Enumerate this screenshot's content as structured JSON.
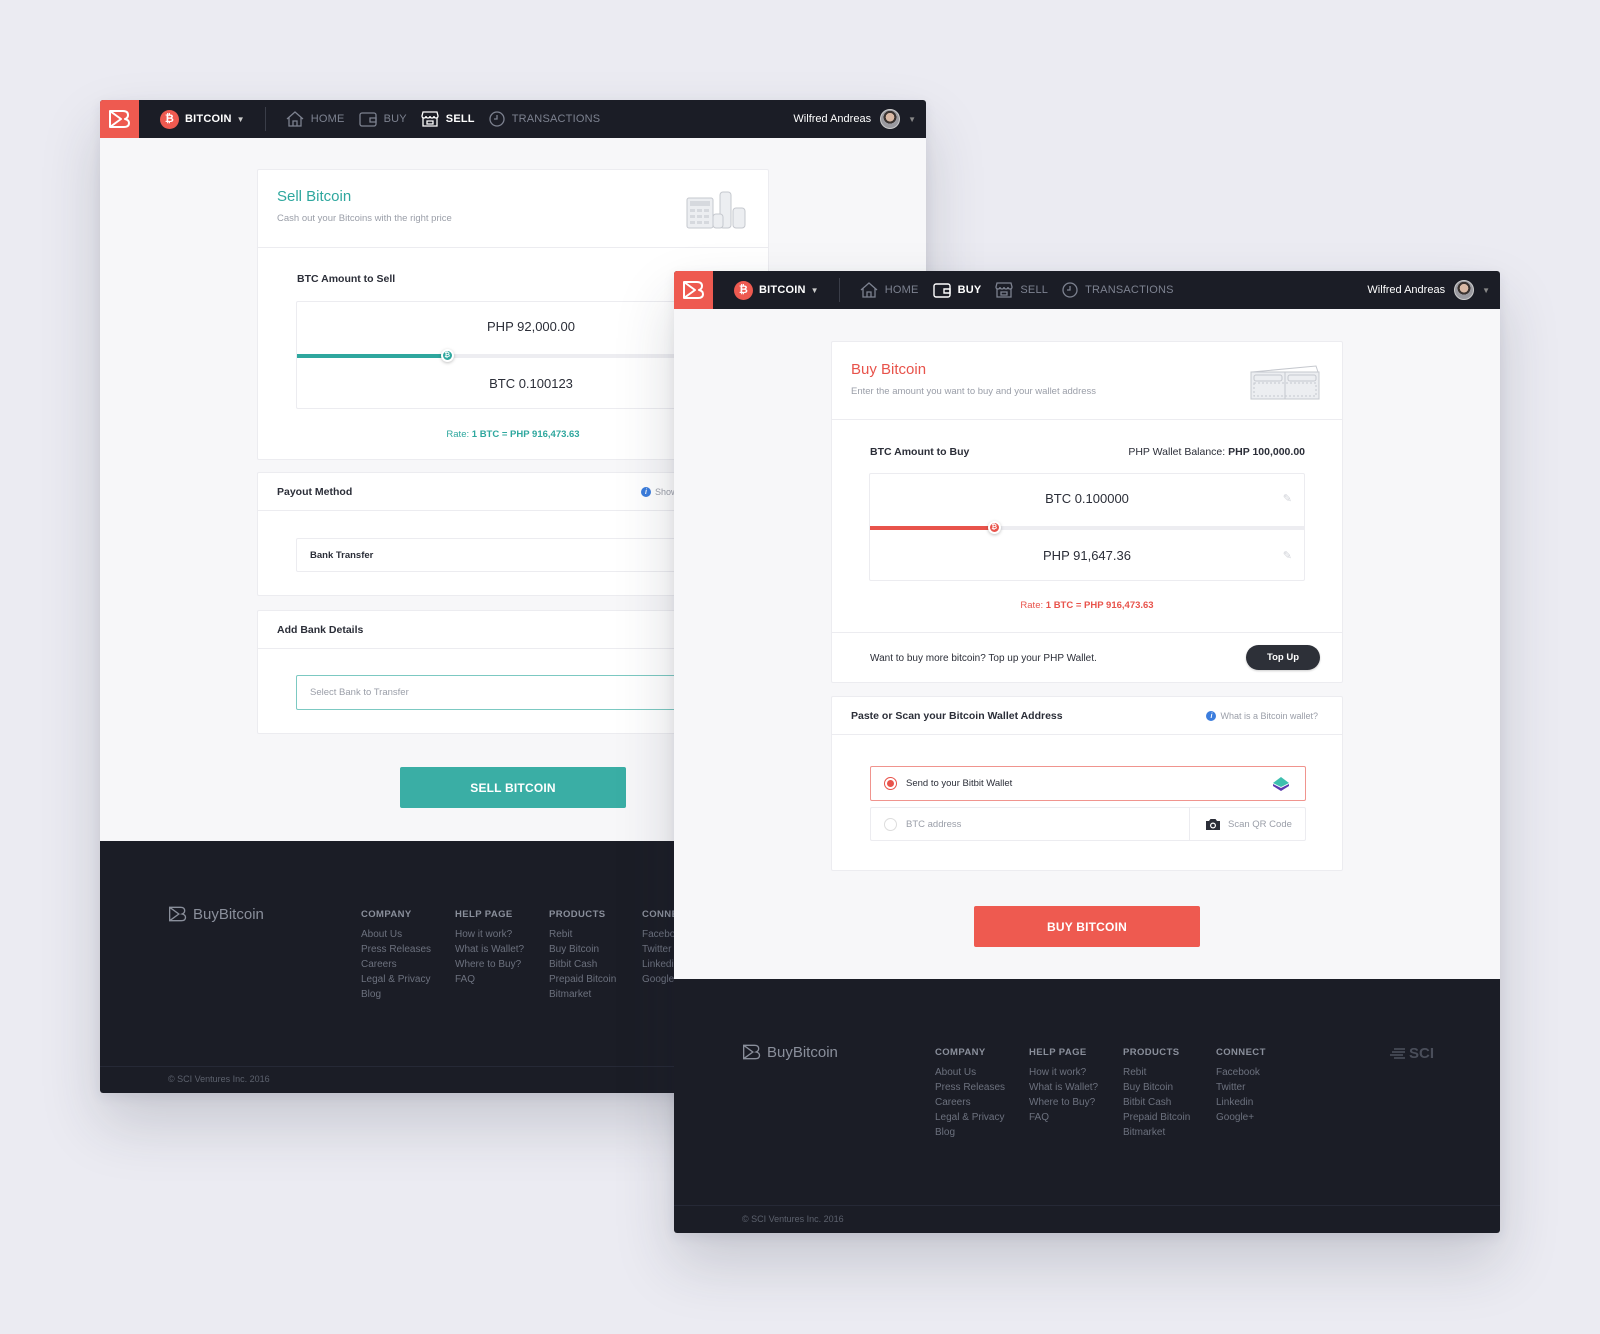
{
  "brand": {
    "name": "BuyBitcoin",
    "accent_sell": "#2ea79e",
    "accent_buy": "#e8534b",
    "nav_bg": "#1b1d26"
  },
  "nav": {
    "coin_badge": "₿",
    "coin_label": "BITCOIN",
    "items": [
      {
        "label": "HOME",
        "icon": "home-icon"
      },
      {
        "label": "BUY",
        "icon": "wallet-icon"
      },
      {
        "label": "SELL",
        "icon": "store-icon"
      },
      {
        "label": "TRANSACTIONS",
        "icon": "clock-icon"
      }
    ],
    "user_name": "Wilfred Andreas"
  },
  "sell": {
    "active_tab": "SELL",
    "title": "Sell Bitcoin",
    "subtitle": "Cash out your Bitcoins with the right price",
    "amount_label": "BTC Amount to Sell",
    "php_value": "PHP 92,000.00",
    "btc_value": "BTC 0.100123",
    "slider_fraction": 0.32,
    "rate_prefix": "Rate:",
    "rate_value": "1 BTC = PHP 916,473.63",
    "payout_title": "Payout Method",
    "payout_help": "Show",
    "payout_value": "Bank Transfer",
    "bank_title": "Add Bank Details",
    "bank_placeholder": "Select Bank to Transfer",
    "submit_label": "SELL BITCOIN"
  },
  "buy": {
    "active_tab": "BUY",
    "title": "Buy Bitcoin",
    "subtitle": "Enter the amount you want to buy and your wallet address",
    "amount_label": "BTC Amount to Buy",
    "balance_label": "PHP Wallet Balance:",
    "balance_value": "PHP 100,000.00",
    "btc_value": "BTC 0.100000",
    "php_value": "PHP 91,647.36",
    "slider_fraction": 0.285,
    "rate_prefix": "Rate:",
    "rate_value": "1 BTC = PHP 916,473.63",
    "topup_text": "Want to buy more bitcoin? Top up your PHP Wallet.",
    "topup_label": "Top Up",
    "wallet_title": "Paste or Scan your Bitcoin Wallet Address",
    "wallet_help": "What is a Bitcoin wallet?",
    "option_bitbit": "Send to your Bitbit Wallet",
    "option_address_placeholder": "BTC address",
    "scan_label": "Scan QR Code",
    "submit_label": "BUY BITCOIN"
  },
  "footer": {
    "logo_text": "BuyBitcoin",
    "columns": [
      {
        "heading": "COMPANY",
        "links": [
          "About Us",
          "Press Releases",
          "Careers",
          "Legal & Privacy",
          "Blog"
        ]
      },
      {
        "heading": "HELP PAGE",
        "links": [
          "How it work?",
          "What is Wallet?",
          "Where to Buy?",
          "FAQ"
        ]
      },
      {
        "heading": "PRODUCTS",
        "links": [
          "Rebit",
          "Buy Bitcoin",
          "Bitbit Cash",
          "Prepaid Bitcoin",
          "Bitmarket"
        ]
      },
      {
        "heading": "CONNECT",
        "links": [
          "Facebook",
          "Twitter",
          "Linkedin",
          "Google+"
        ]
      }
    ],
    "partner_logo": "SCI",
    "copyright": "© SCI Ventures Inc. 2016"
  }
}
